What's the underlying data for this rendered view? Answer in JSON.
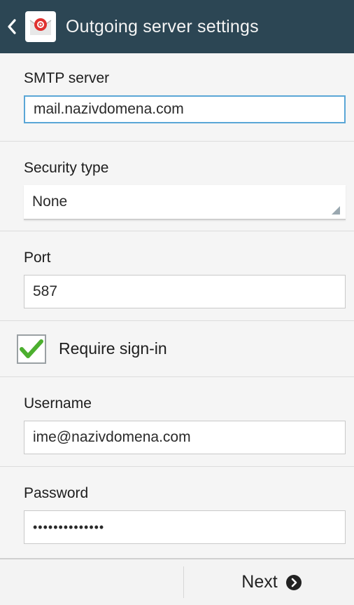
{
  "header": {
    "title": "Outgoing server settings",
    "back_icon": "chevron-left-icon",
    "app_icon": "email-app-icon"
  },
  "smtp": {
    "label": "SMTP server",
    "value": "mail.nazivdomena.com"
  },
  "security": {
    "label": "Security type",
    "value": "None"
  },
  "port": {
    "label": "Port",
    "value": "587"
  },
  "require_signin": {
    "label": "Require sign-in",
    "checked": true
  },
  "username": {
    "label": "Username",
    "value": "ime@nazivdomena.com"
  },
  "password": {
    "label": "Password",
    "value": "••••••••••••••"
  },
  "footer": {
    "next_label": "Next",
    "next_icon": "arrow-right-circle-icon"
  },
  "colors": {
    "titlebar": "#2c4654",
    "focus_border": "#5aa6d6",
    "check_green": "#4caf2f"
  }
}
